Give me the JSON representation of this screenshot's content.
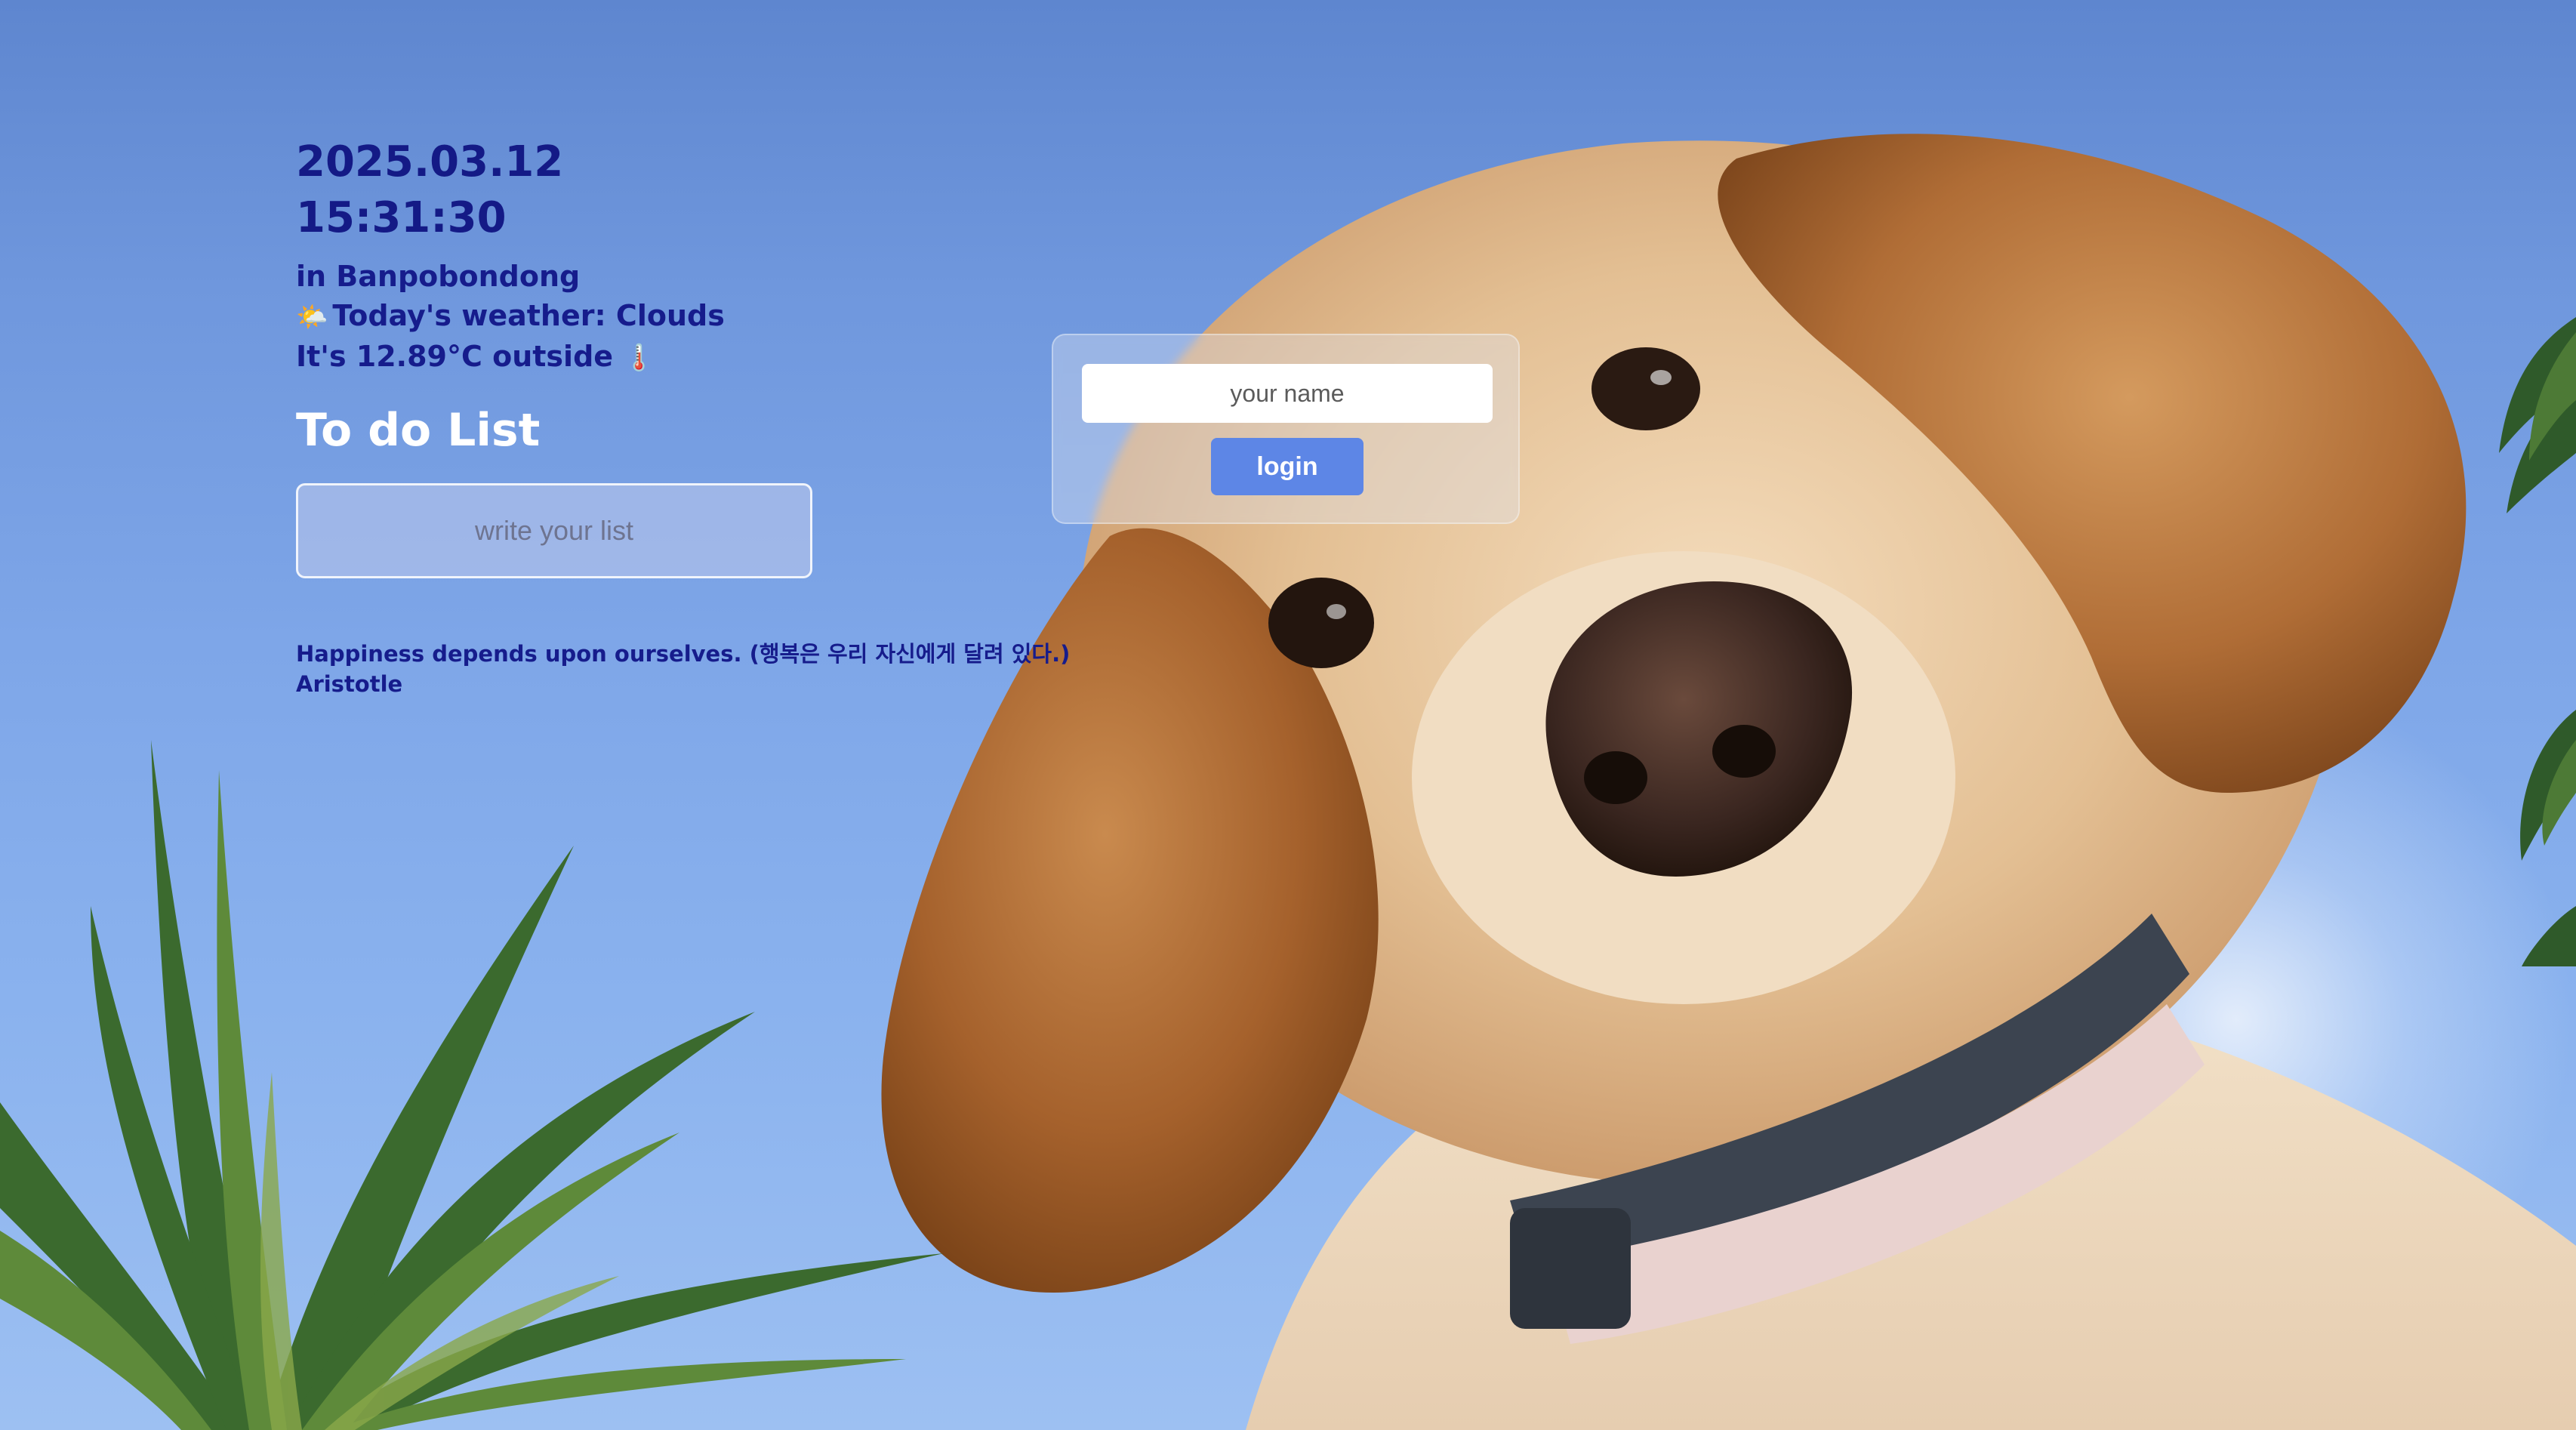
{
  "clock": {
    "date": "2025.03.12",
    "time": "15:31:30"
  },
  "weather": {
    "location_line": "in Banpobondong",
    "weather_emoji": "🌤️",
    "weather_line": "Today's weather: Clouds",
    "temperature_line": "It's 12.89°C outside",
    "thermometer_emoji": "🌡️"
  },
  "todo": {
    "title": "To do List",
    "placeholder": "write your list"
  },
  "quote": {
    "text": "Happiness depends upon ourselves. (행복은 우리 자신에게 달려 있다.)",
    "author": "Aristotle"
  },
  "login": {
    "name_placeholder": "your name",
    "button_label": "login"
  },
  "colors": {
    "text_primary": "#161c8c",
    "heading_white": "#ffffff",
    "button_blue": "#5d86e6",
    "sky_blue": "#6f97dd"
  }
}
